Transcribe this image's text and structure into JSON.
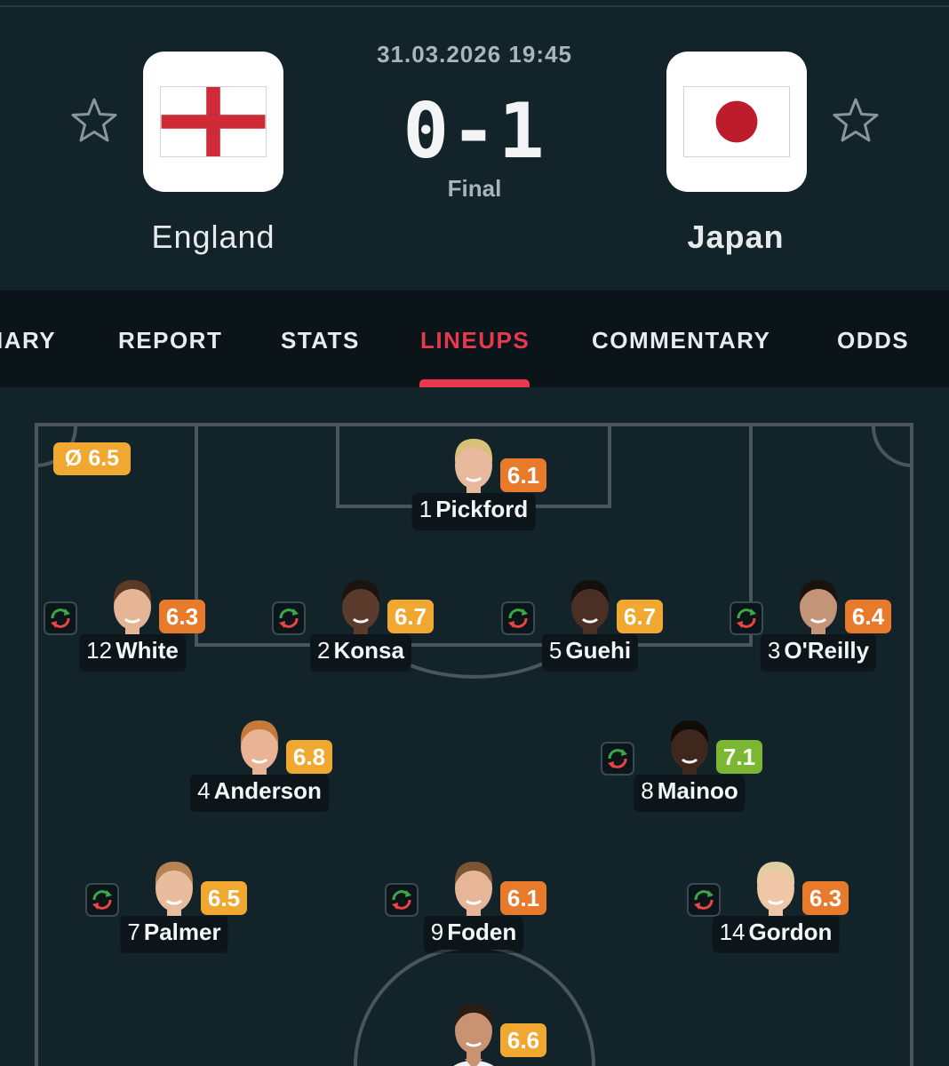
{
  "match": {
    "datetime": "31.03.2026 19:45",
    "score": "0-1",
    "status": "Final",
    "home": {
      "name": "England",
      "flag_icon": "england-flag-icon"
    },
    "away": {
      "name": "Japan",
      "flag_icon": "japan-flag-icon"
    }
  },
  "tabs": [
    {
      "label": "IARY"
    },
    {
      "label": "REPORT"
    },
    {
      "label": "STATS"
    },
    {
      "label": "LINEUPS",
      "active": true
    },
    {
      "label": "COMMENTARY"
    },
    {
      "label": "ODDS"
    }
  ],
  "team_average": "Ø 6.5",
  "colors": {
    "accent": "#e8384f",
    "rating_orange": "#e87a2c",
    "rating_amber": "#f0a830",
    "rating_green": "#7bb733",
    "background": "#13232a"
  },
  "players": [
    {
      "number": "1",
      "name": "Pickford",
      "rating": "6.1",
      "rating_color": "#e87a2c",
      "sub": false
    },
    {
      "number": "12",
      "name": "White",
      "rating": "6.3",
      "rating_color": "#e87a2c",
      "sub": true
    },
    {
      "number": "2",
      "name": "Konsa",
      "rating": "6.7",
      "rating_color": "#f0a830",
      "sub": true
    },
    {
      "number": "5",
      "name": "Guehi",
      "rating": "6.7",
      "rating_color": "#f0a830",
      "sub": true
    },
    {
      "number": "3",
      "name": "O'Reilly",
      "rating": "6.4",
      "rating_color": "#e87a2c",
      "sub": true
    },
    {
      "number": "4",
      "name": "Anderson",
      "rating": "6.8",
      "rating_color": "#f0a830",
      "sub": false
    },
    {
      "number": "8",
      "name": "Mainoo",
      "rating": "7.1",
      "rating_color": "#7bb733",
      "sub": true
    },
    {
      "number": "7",
      "name": "Palmer",
      "rating": "6.5",
      "rating_color": "#f0a830",
      "sub": true
    },
    {
      "number": "9",
      "name": "Foden",
      "rating": "6.1",
      "rating_color": "#e87a2c",
      "sub": true
    },
    {
      "number": "14",
      "name": "Gordon",
      "rating": "6.3",
      "rating_color": "#e87a2c",
      "sub": true
    },
    {
      "number": "",
      "name": "",
      "rating": "6.6",
      "rating_color": "#f0a830",
      "sub": false
    }
  ]
}
